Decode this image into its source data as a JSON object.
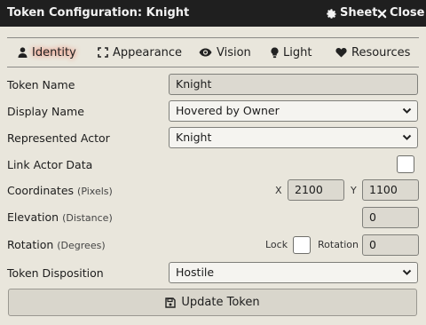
{
  "titlebar": {
    "title": "Token Configuration: Knight",
    "sheet_label": "Sheet",
    "close_label": "Close"
  },
  "tabs": [
    {
      "label": "Identity",
      "icon": "user-icon",
      "active": true
    },
    {
      "label": "Appearance",
      "icon": "expand-icon",
      "active": false
    },
    {
      "label": "Vision",
      "icon": "eye-icon",
      "active": false
    },
    {
      "label": "Light",
      "icon": "lightbulb-icon",
      "active": false
    },
    {
      "label": "Resources",
      "icon": "heart-icon",
      "active": false
    }
  ],
  "form": {
    "token_name": {
      "label": "Token Name",
      "value": "Knight"
    },
    "display_name": {
      "label": "Display Name",
      "value": "Hovered by Owner"
    },
    "represented_actor": {
      "label": "Represented Actor",
      "value": "Knight"
    },
    "link_actor_data": {
      "label": "Link Actor Data",
      "checked": false
    },
    "coordinates": {
      "label": "Coordinates",
      "hint": "(Pixels)",
      "x_label": "X",
      "x_value": "2100",
      "y_label": "Y",
      "y_value": "1100"
    },
    "elevation": {
      "label": "Elevation",
      "hint": "(Distance)",
      "value": "0"
    },
    "rotation": {
      "label": "Rotation",
      "hint": "(Degrees)",
      "lock_label": "Lock",
      "lock_checked": false,
      "rotation_label": "Rotation",
      "value": "0"
    },
    "token_disposition": {
      "label": "Token Disposition",
      "value": "Hostile"
    }
  },
  "submit": {
    "label": "Update Token",
    "icon": "save-icon"
  },
  "colors": {
    "titlebar_bg": "#1f1f1f",
    "window_bg": "#e9e6dc",
    "active_tab_glow": "#ff5a3d"
  }
}
